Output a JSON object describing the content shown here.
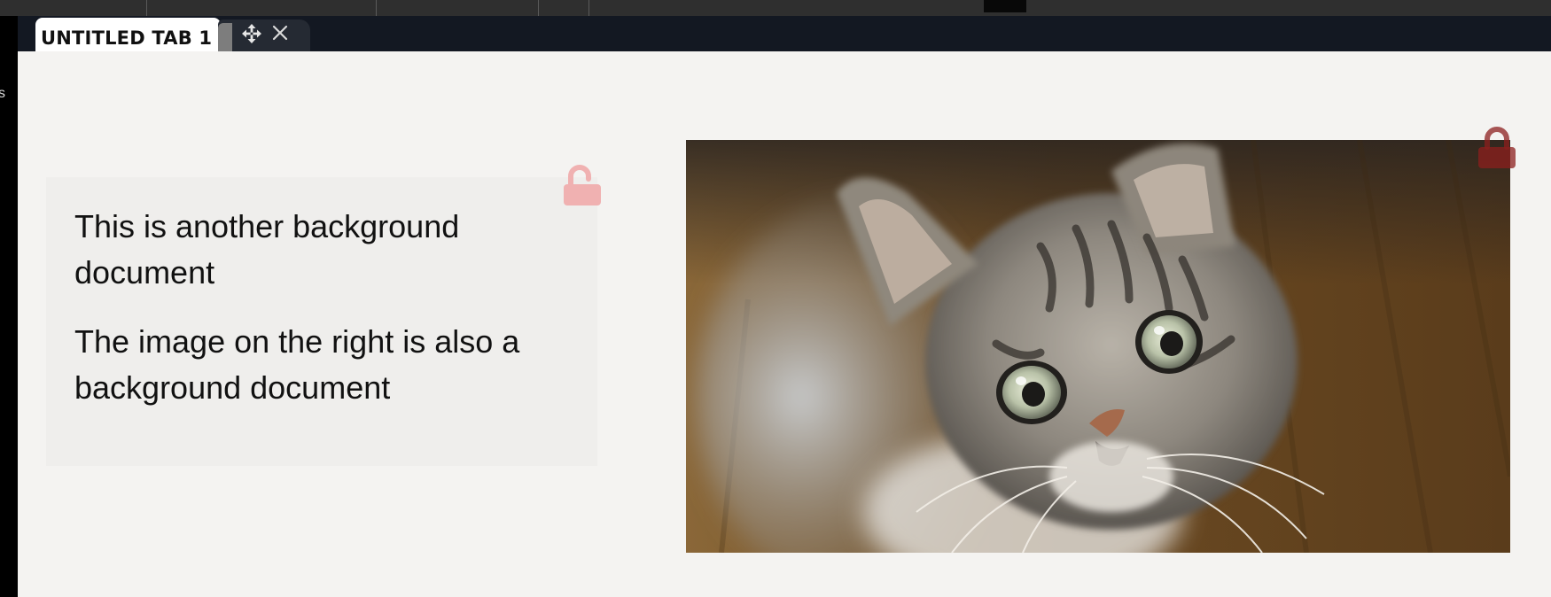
{
  "tabs": {
    "active": {
      "label": "UNTITLED TAB 1"
    }
  },
  "left_rail": {
    "glyph": "s"
  },
  "text_document": {
    "paragraph1": "This is another background document",
    "paragraph2": "The image on the right is also a background document"
  },
  "image_document": {
    "alt": "tabby kitten looking up"
  },
  "icons": {
    "move": "move-arrows-icon",
    "close": "close-icon",
    "unlocked": "unlocked-padlock-icon",
    "locked": "locked-padlock-icon"
  },
  "colors": {
    "page_background": "#f4f3f1",
    "tab_bar": "#131822",
    "unlocked_lock": "#f0b1b1",
    "locked_lock": "#8c1f1d"
  }
}
